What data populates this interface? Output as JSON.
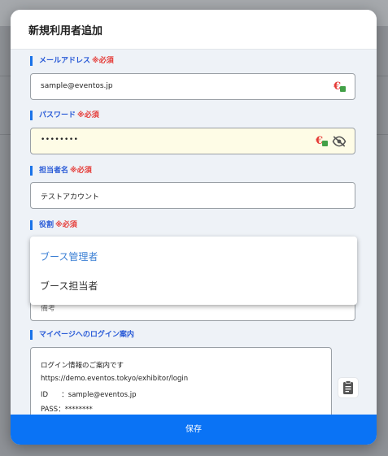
{
  "modal": {
    "title": "新規利用者追加"
  },
  "fields": {
    "email": {
      "label": "メールアドレス",
      "required": "※必須",
      "value": "sample@eventos.jp"
    },
    "password": {
      "label": "パスワード",
      "required": "※必須",
      "value": "••••••••"
    },
    "contact_name": {
      "label": "担当者名",
      "required": "※必須",
      "value": "テストアカウント"
    },
    "role": {
      "label": "役割",
      "required": "※必須"
    },
    "hidden_field": {
      "placeholder_partial": "備考"
    },
    "mypage": {
      "label": "マイページへのログイン案内",
      "lines": [
        "ログイン情報のご案内です",
        "https://demo.eventos.tokyo/exhibitor/login",
        "ID      ：sample@eventos.jp",
        "PASS：********"
      ]
    }
  },
  "role_dropdown": {
    "options": [
      "ブース管理者",
      "ブース担当者"
    ],
    "highlighted_index": 0
  },
  "footer": {
    "save_label": "保存"
  },
  "icons": {
    "password_manager": "password-manager-icon",
    "visibility_off": "eye-off-icon",
    "clipboard": "clipboard-icon"
  },
  "colors": {
    "accent": "#1a73e8",
    "required": "#e53935",
    "save_button": "#0a73f5",
    "selected_option": "#3b7fd4"
  }
}
